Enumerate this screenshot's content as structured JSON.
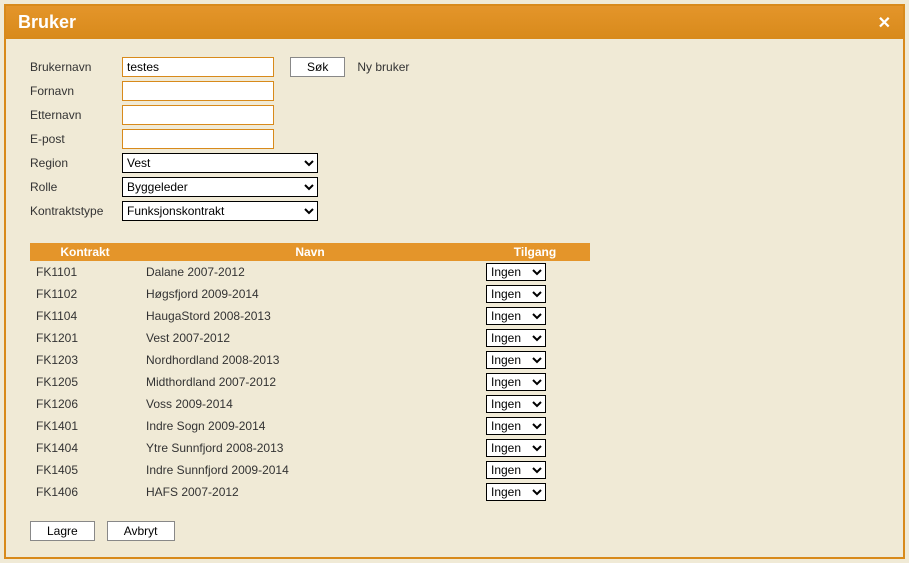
{
  "dialog": {
    "title": "Bruker"
  },
  "form": {
    "brukernavn": {
      "label": "Brukernavn",
      "value": "testes"
    },
    "fornavn": {
      "label": "Fornavn",
      "value": ""
    },
    "etternavn": {
      "label": "Etternavn",
      "value": ""
    },
    "epost": {
      "label": "E-post",
      "value": ""
    },
    "region": {
      "label": "Region",
      "value": "Vest"
    },
    "rolle": {
      "label": "Rolle",
      "value": "Byggeleder"
    },
    "kontraktstype": {
      "label": "Kontraktstype",
      "value": "Funksjonskontrakt"
    },
    "sok_label": "Søk",
    "ny_bruker_label": "Ny bruker"
  },
  "table": {
    "headers": {
      "kontrakt": "Kontrakt",
      "navn": "Navn",
      "tilgang": "Tilgang"
    },
    "tilgang_default": "Ingen",
    "rows": [
      {
        "kontrakt": "FK1101",
        "navn": "Dalane 2007-2012",
        "tilgang": "Ingen"
      },
      {
        "kontrakt": "FK1102",
        "navn": "Høgsfjord 2009-2014",
        "tilgang": "Ingen"
      },
      {
        "kontrakt": "FK1104",
        "navn": "HaugaStord 2008-2013",
        "tilgang": "Ingen"
      },
      {
        "kontrakt": "FK1201",
        "navn": "Vest 2007-2012",
        "tilgang": "Ingen"
      },
      {
        "kontrakt": "FK1203",
        "navn": "Nordhordland 2008-2013",
        "tilgang": "Ingen"
      },
      {
        "kontrakt": "FK1205",
        "navn": "Midthordland 2007-2012",
        "tilgang": "Ingen"
      },
      {
        "kontrakt": "FK1206",
        "navn": "Voss 2009-2014",
        "tilgang": "Ingen"
      },
      {
        "kontrakt": "FK1401",
        "navn": "Indre Sogn 2009-2014",
        "tilgang": "Ingen"
      },
      {
        "kontrakt": "FK1404",
        "navn": "Ytre Sunnfjord 2008-2013",
        "tilgang": "Ingen"
      },
      {
        "kontrakt": "FK1405",
        "navn": "Indre Sunnfjord 2009-2014",
        "tilgang": "Ingen"
      },
      {
        "kontrakt": "FK1406",
        "navn": "HAFS 2007-2012",
        "tilgang": "Ingen"
      }
    ]
  },
  "footer": {
    "lagre": "Lagre",
    "avbryt": "Avbryt"
  }
}
